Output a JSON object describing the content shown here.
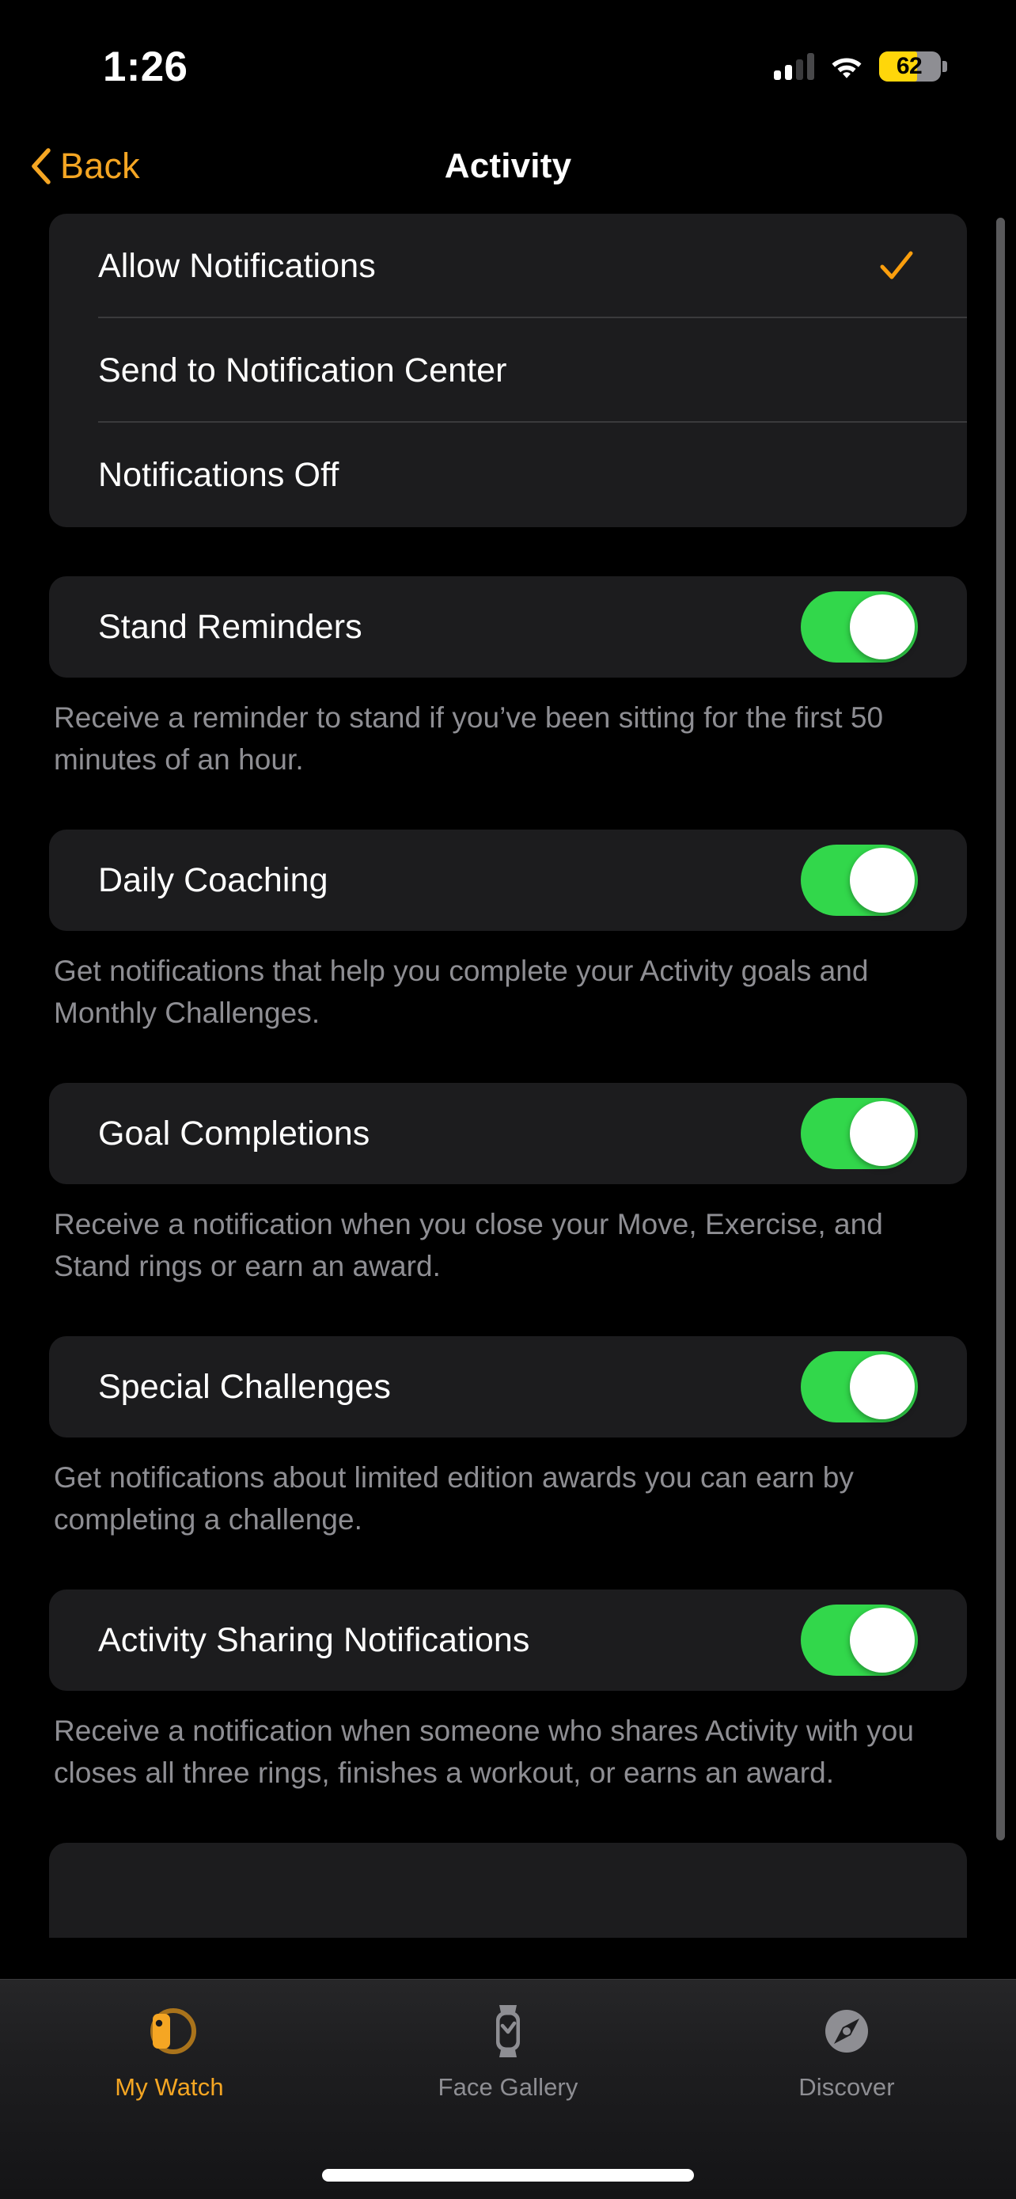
{
  "status_bar": {
    "time": "1:26",
    "battery_percent": "62",
    "battery_level": 62,
    "battery_color": "#FFD60A",
    "signal_bars_filled": 2,
    "signal_bars_total": 4,
    "wifi": "wifi-icon"
  },
  "nav": {
    "back_label": "Back",
    "title": "Activity",
    "accent_color": "#F5A623"
  },
  "notification_style": {
    "options": [
      {
        "label": "Allow Notifications",
        "selected": true
      },
      {
        "label": "Send to Notification Center",
        "selected": false
      },
      {
        "label": "Notifications Off",
        "selected": false
      }
    ]
  },
  "settings": [
    {
      "label": "Stand Reminders",
      "toggle_on": true,
      "description": "Receive a reminder to stand if you’ve been sitting for the first 50 minutes of an hour."
    },
    {
      "label": "Daily Coaching",
      "toggle_on": true,
      "description": "Get notifications that help you complete your Activity goals and Monthly Challenges."
    },
    {
      "label": "Goal Completions",
      "toggle_on": true,
      "description": "Receive a notification when you close your Move, Exercise, and Stand rings or earn an award."
    },
    {
      "label": "Special Challenges",
      "toggle_on": true,
      "description": "Get notifications about limited edition awards you can earn by completing a challenge."
    },
    {
      "label": "Activity Sharing Notifications",
      "toggle_on": true,
      "description": "Receive a notification when someone who shares Activity with you closes all three rings, finishes a workout, or earns an award."
    }
  ],
  "colors": {
    "toggle_on": "#32D74B",
    "card_bg": "#1C1C1E",
    "page_bg": "#000000",
    "secondary_text": "#8E8E93",
    "separator": "#3A3A3C"
  },
  "tab_bar": {
    "tabs": [
      {
        "label": "My Watch",
        "icon": "watch-side-icon",
        "active": true
      },
      {
        "label": "Face Gallery",
        "icon": "watch-face-icon",
        "active": false
      },
      {
        "label": "Discover",
        "icon": "compass-icon",
        "active": false
      }
    ]
  }
}
